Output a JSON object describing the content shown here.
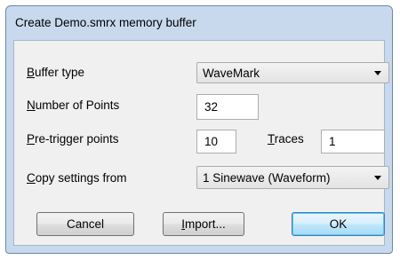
{
  "window": {
    "title": "Create Demo.smrx memory buffer"
  },
  "fields": {
    "buffer_type": {
      "label_key": "B",
      "label_rest": "uffer type",
      "value": "WaveMark"
    },
    "number_of_points": {
      "label_key": "N",
      "label_rest": "umber of Points",
      "value": "32"
    },
    "pre_trigger_points": {
      "label_key": "P",
      "label_rest": "re-trigger points",
      "value": "10"
    },
    "traces": {
      "label_key": "T",
      "label_rest": "races",
      "value": "1"
    },
    "copy_settings_from": {
      "label_key": "C",
      "label_rest": "opy settings from",
      "value": "1 Sinewave (Waveform)"
    }
  },
  "buttons": {
    "cancel": "Cancel",
    "import_key": "I",
    "import_rest": "mport...",
    "ok": "OK"
  },
  "icons": {
    "dropdown": "chevron-down-icon"
  }
}
